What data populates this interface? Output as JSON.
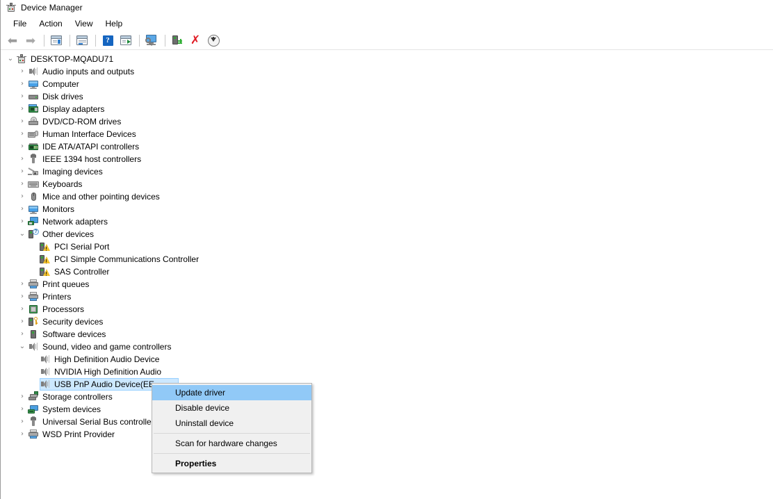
{
  "window": {
    "title": "Device Manager",
    "title_icon": "device-manager-icon"
  },
  "menubar": {
    "items": [
      {
        "label": "File"
      },
      {
        "label": "Action"
      },
      {
        "label": "View"
      },
      {
        "label": "Help"
      }
    ]
  },
  "toolbar": {
    "buttons": [
      {
        "name": "back-button",
        "icon": "back-arrow-icon"
      },
      {
        "name": "forward-button",
        "icon": "forward-arrow-icon"
      },
      {
        "name": "show-hide-console-tree-button",
        "icon": "console-tree-icon"
      },
      {
        "name": "properties-button",
        "icon": "properties-window-icon"
      },
      {
        "name": "help-button",
        "icon": "help-question-icon"
      },
      {
        "name": "update-driver-software-button",
        "icon": "driver-update-icon"
      },
      {
        "name": "scan-for-hardware-changes-button",
        "icon": "scan-monitor-magnifier-icon"
      },
      {
        "name": "enable-device-button",
        "icon": "device-green-plug-icon"
      },
      {
        "name": "uninstall-device-button",
        "icon": "red-x-icon"
      },
      {
        "name": "download-button",
        "icon": "download-arrow-icon"
      }
    ]
  },
  "progress": {
    "accent_color": "#ffc40a",
    "track_color": "#e3e3e3"
  },
  "tree": {
    "root": {
      "label": "DESKTOP-MQADU71",
      "icon": "computer-root-icon",
      "expanded": true,
      "chevron": "⌄"
    },
    "nodes": [
      {
        "label": "Audio inputs and outputs",
        "icon": "speaker-icon",
        "depth": 1,
        "expandable": true,
        "expanded": false
      },
      {
        "label": "Computer",
        "icon": "monitor-icon",
        "depth": 1,
        "expandable": true,
        "expanded": false
      },
      {
        "label": "Disk drives",
        "icon": "disk-drive-icon",
        "depth": 1,
        "expandable": true,
        "expanded": false
      },
      {
        "label": "Display adapters",
        "icon": "display-adapter-icon",
        "depth": 1,
        "expandable": true,
        "expanded": false
      },
      {
        "label": "DVD/CD-ROM drives",
        "icon": "dvd-drive-icon",
        "depth": 1,
        "expandable": true,
        "expanded": false
      },
      {
        "label": "Human Interface Devices",
        "icon": "hid-icon",
        "depth": 1,
        "expandable": true,
        "expanded": false
      },
      {
        "label": "IDE ATA/ATAPI controllers",
        "icon": "ide-controller-icon",
        "depth": 1,
        "expandable": true,
        "expanded": false
      },
      {
        "label": "IEEE 1394 host controllers",
        "icon": "usb-plug-icon",
        "depth": 1,
        "expandable": true,
        "expanded": false
      },
      {
        "label": "Imaging devices",
        "icon": "imaging-device-icon",
        "depth": 1,
        "expandable": true,
        "expanded": false
      },
      {
        "label": "Keyboards",
        "icon": "keyboard-icon",
        "depth": 1,
        "expandable": true,
        "expanded": false
      },
      {
        "label": "Mice and other pointing devices",
        "icon": "mouse-icon",
        "depth": 1,
        "expandable": true,
        "expanded": false
      },
      {
        "label": "Monitors",
        "icon": "monitor-icon",
        "depth": 1,
        "expandable": true,
        "expanded": false
      },
      {
        "label": "Network adapters",
        "icon": "network-adapter-icon",
        "depth": 1,
        "expandable": true,
        "expanded": false
      },
      {
        "label": "Other devices",
        "icon": "other-devices-icon",
        "depth": 1,
        "expandable": true,
        "expanded": true
      },
      {
        "label": "PCI Serial Port",
        "icon": "unknown-device-warning-icon",
        "depth": 2,
        "expandable": false,
        "expanded": false
      },
      {
        "label": "PCI Simple Communications Controller",
        "icon": "unknown-device-warning-icon",
        "depth": 2,
        "expandable": false,
        "expanded": false
      },
      {
        "label": "SAS Controller",
        "icon": "unknown-device-warning-icon",
        "depth": 2,
        "expandable": false,
        "expanded": false
      },
      {
        "label": "Print queues",
        "icon": "printer-icon",
        "depth": 1,
        "expandable": true,
        "expanded": false
      },
      {
        "label": "Printers",
        "icon": "printer-icon",
        "depth": 1,
        "expandable": true,
        "expanded": false
      },
      {
        "label": "Processors",
        "icon": "processor-icon",
        "depth": 1,
        "expandable": true,
        "expanded": false
      },
      {
        "label": "Security devices",
        "icon": "security-device-icon",
        "depth": 1,
        "expandable": true,
        "expanded": false
      },
      {
        "label": "Software devices",
        "icon": "software-device-icon",
        "depth": 1,
        "expandable": true,
        "expanded": false
      },
      {
        "label": "Sound, video and game controllers",
        "icon": "speaker-icon",
        "depth": 1,
        "expandable": true,
        "expanded": true
      },
      {
        "label": "High Definition Audio Device",
        "icon": "speaker-icon",
        "depth": 2,
        "expandable": false,
        "expanded": false
      },
      {
        "label": "NVIDIA High Definition Audio",
        "icon": "speaker-icon",
        "depth": 2,
        "expandable": false,
        "expanded": false
      },
      {
        "label": "USB PnP Audio Device(EE",
        "icon": "speaker-icon",
        "depth": 2,
        "expandable": false,
        "expanded": false,
        "selected": true
      },
      {
        "label": "Storage controllers",
        "icon": "storage-controller-icon",
        "depth": 1,
        "expandable": true,
        "expanded": false
      },
      {
        "label": "System devices",
        "icon": "system-device-icon",
        "depth": 1,
        "expandable": true,
        "expanded": false
      },
      {
        "label": "Universal Serial Bus controlle",
        "icon": "usb-plug-icon",
        "depth": 1,
        "expandable": true,
        "expanded": false
      },
      {
        "label": "WSD Print Provider",
        "icon": "printer-icon",
        "depth": 1,
        "expandable": true,
        "expanded": false
      }
    ],
    "chevron_collapsed": "›",
    "chevron_expanded": "⌄",
    "selection_color": "#cce8ff"
  },
  "context_menu": {
    "highlight_color": "#91c9f7",
    "items": [
      {
        "label": "Update driver",
        "highlighted": true,
        "bold": false,
        "type": "item"
      },
      {
        "label": "Disable device",
        "highlighted": false,
        "bold": false,
        "type": "item"
      },
      {
        "label": "Uninstall device",
        "highlighted": false,
        "bold": false,
        "type": "item"
      },
      {
        "type": "separator"
      },
      {
        "label": "Scan for hardware changes",
        "highlighted": false,
        "bold": false,
        "type": "item"
      },
      {
        "type": "separator"
      },
      {
        "label": "Properties",
        "highlighted": false,
        "bold": true,
        "type": "item"
      }
    ]
  }
}
